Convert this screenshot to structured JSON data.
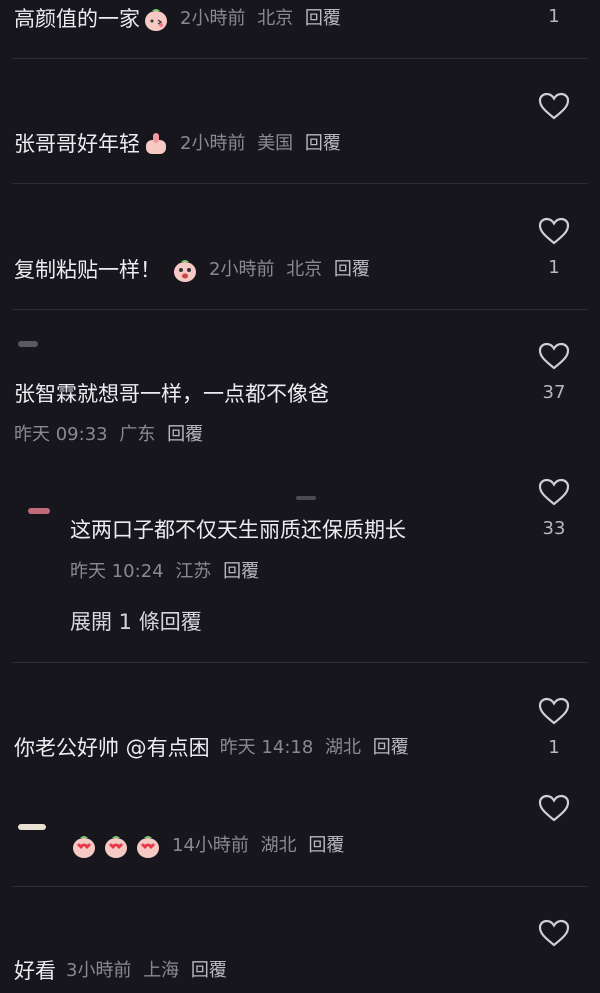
{
  "comments": [
    {
      "text": "高颜值的一家",
      "time": "2小時前",
      "location": "北京",
      "reply": "回覆",
      "likes": "1"
    },
    {
      "text": "张哥哥好年轻",
      "time": "2小時前",
      "location": "美国",
      "reply": "回覆",
      "likes": ""
    },
    {
      "text": "复制粘贴一样！",
      "time": "2小時前",
      "location": "北京",
      "reply": "回覆",
      "likes": "1"
    },
    {
      "text": "张智霖就想哥一样，一点都不像爸",
      "time": "昨天 09:33",
      "location": "广东",
      "reply": "回覆",
      "likes": "37"
    },
    {
      "text": "这两口子都不仅天生丽质还保质期长",
      "time": "昨天 10:24",
      "location": "江苏",
      "reply": "回覆",
      "likes": "33"
    },
    {
      "text": "你老公好帅 @有点困",
      "time": "昨天 14:18",
      "location": "湖北",
      "reply": "回覆",
      "likes": "1"
    },
    {
      "text": "",
      "time": "14小時前",
      "location": "湖北",
      "reply": "回覆",
      "likes": ""
    },
    {
      "text": "好看",
      "time": "3小時前",
      "location": "上海",
      "reply": "回覆",
      "likes": ""
    }
  ],
  "expand_replies": "展開 1 條回覆",
  "icons": {
    "heart": "heart-outline-icon",
    "emoji": "peach-face-emoji"
  },
  "colors": {
    "background": "#16161c",
    "text": "#ecebf0",
    "meta": "#8a8992",
    "divider": "#2c2c34"
  }
}
